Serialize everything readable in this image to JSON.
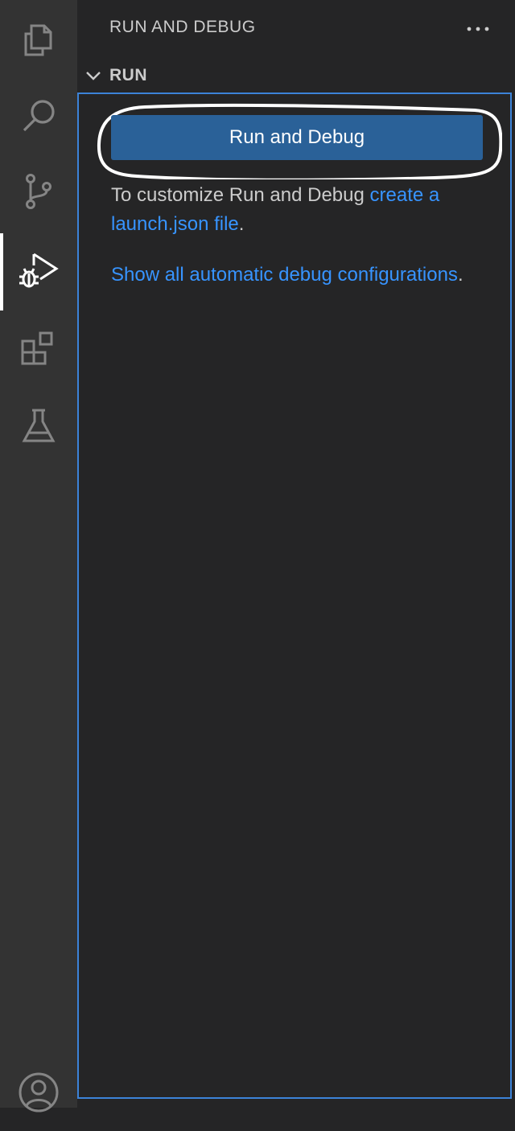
{
  "activity_bar": {
    "items": [
      {
        "icon": "files-icon",
        "active": false
      },
      {
        "icon": "search-icon",
        "active": false
      },
      {
        "icon": "source-control-icon",
        "active": false
      },
      {
        "icon": "run-debug-icon",
        "active": true
      },
      {
        "icon": "extensions-icon",
        "active": false
      },
      {
        "icon": "testing-icon",
        "active": false
      }
    ],
    "bottom_icon": "accounts-icon"
  },
  "sidebar": {
    "title": "RUN AND DEBUG",
    "more_icon": "ellipsis-icon",
    "section": {
      "label": "RUN",
      "chevron_icon": "chevron-down-icon",
      "button_label": "Run and Debug",
      "customize_prefix": "To customize Run and Debug ",
      "customize_link": "create a launch.json file",
      "customize_suffix": ".",
      "show_all_link": "Show all automatic debug configurations",
      "show_all_suffix": "."
    }
  },
  "colors": {
    "activity_bar_bg": "#333333",
    "sidebar_bg": "#252526",
    "button_bg": "#2a6198",
    "link": "#3794ff",
    "focus_border": "#3c83d8",
    "text": "#cccccc"
  }
}
